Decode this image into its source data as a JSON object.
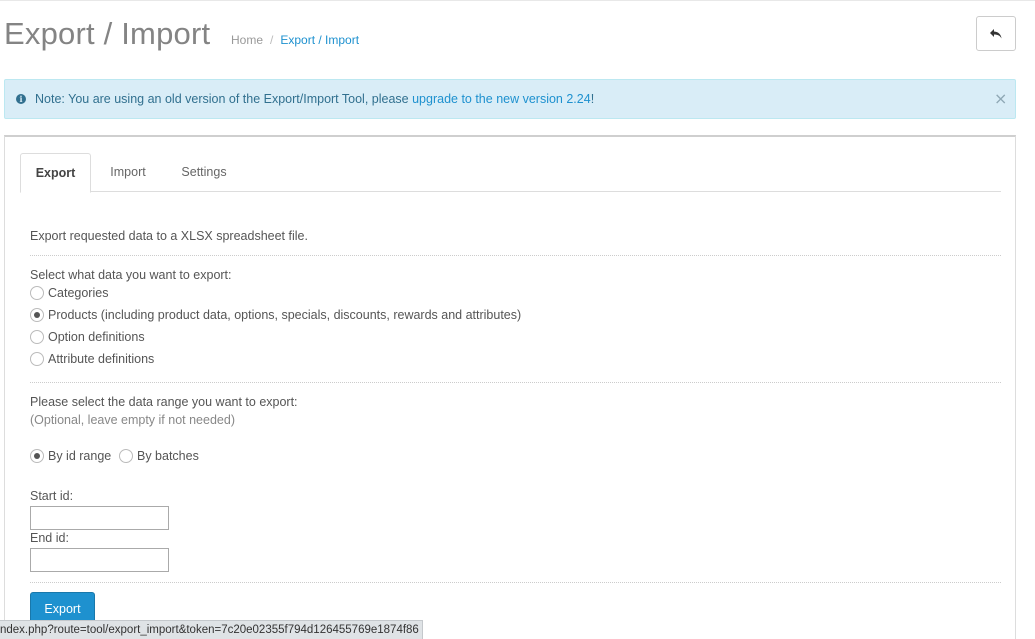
{
  "header": {
    "title": "Export / Import",
    "breadcrumb": [
      {
        "label": "Home"
      },
      {
        "label": "Export / Import"
      }
    ],
    "breadcrumb_separator": "/",
    "back_icon": "reply-icon"
  },
  "alert": {
    "text": "Note: You are using an old version of the Export/Import Tool, please ",
    "link": "upgrade to the new version 2.24",
    "suffix": "!",
    "close": "×",
    "icon": "info-circle-icon"
  },
  "tabs": [
    {
      "label": "Export",
      "active": true
    },
    {
      "label": "Import",
      "active": false
    },
    {
      "label": "Settings",
      "active": false
    }
  ],
  "export": {
    "intro": "Export requested data to a XLSX spreadsheet file.",
    "select_label": "Select what data you want to export:",
    "types": [
      {
        "label": "Categories",
        "checked": false
      },
      {
        "label": "Products (including product data, options, specials, discounts, rewards and attributes)",
        "checked": true
      },
      {
        "label": "Option definitions",
        "checked": false
      },
      {
        "label": "Attribute definitions",
        "checked": false
      }
    ],
    "range_label": "Please select the data range you want to export:",
    "range_hint": "(Optional, leave empty if not needed)",
    "range_modes": [
      {
        "label": "By id range",
        "checked": true
      },
      {
        "label": "By batches",
        "checked": false
      }
    ],
    "start_label": "Start id:",
    "start_value": "",
    "end_label": "End id:",
    "end_value": "",
    "button": "Export"
  },
  "status_url": "ndex.php?route=tool/export_import&token=7c20e02355f794d126455769e1874f86",
  "colors": {
    "accent": "#1e91cf",
    "alert_bg": "#d9edf7",
    "alert_text": "#31708f"
  }
}
